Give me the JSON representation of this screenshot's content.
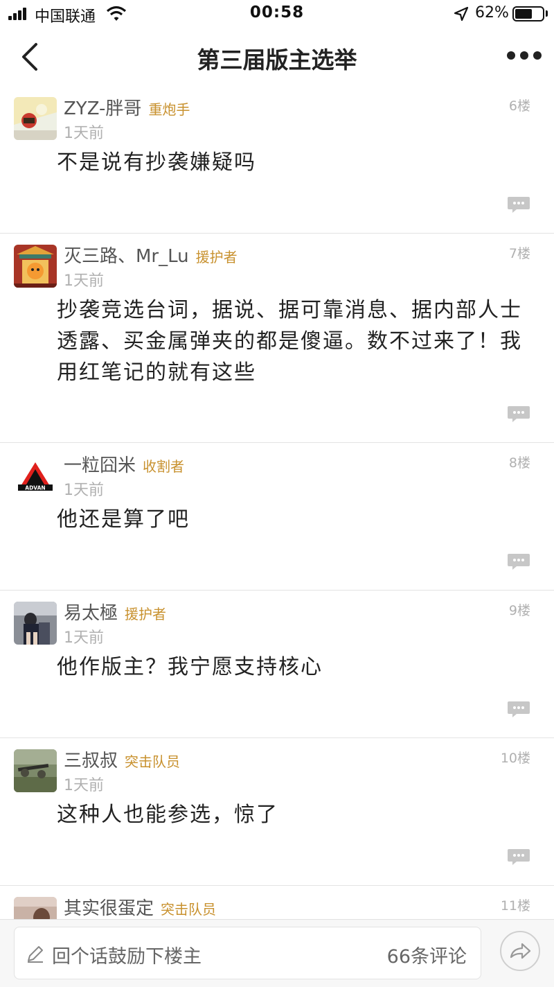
{
  "status_bar": {
    "carrier": "中国联通",
    "time": "00:58",
    "battery_pct": "62%",
    "battery_level": 0.62
  },
  "nav": {
    "title": "第三届版主选举"
  },
  "comments": [
    {
      "username": "ZYZ-胖哥",
      "badge": "重炮手",
      "floor": "6楼",
      "time": "1天前",
      "text": "不是说有抄袭嫌疑吗"
    },
    {
      "username": "灭三路、Mr_Lu",
      "badge": "援护者",
      "floor": "7楼",
      "time": "1天前",
      "text": "抄袭竞选台词，据说、据可靠消息、据内部人士透露、买金属弹夹的都是傻逼。数不过来了！我用红笔记的就有这些"
    },
    {
      "username": "一粒囧米",
      "badge": "收割者",
      "floor": "8楼",
      "time": "1天前",
      "text": "他还是算了吧"
    },
    {
      "username": "易太極",
      "badge": "援护者",
      "floor": "9楼",
      "time": "1天前",
      "text": "他作版主？我宁愿支持核心"
    },
    {
      "username": "三叔叔",
      "badge": "突击队员",
      "floor": "10楼",
      "time": "1天前",
      "text": "这种人也能参选，惊了"
    },
    {
      "username": "其实很蛋定",
      "badge": "突击队员",
      "floor": "11楼"
    }
  ],
  "avatars": {
    "advan_logo_text": "ADVAN"
  },
  "bottom_bar": {
    "placeholder": "回个话鼓励下楼主",
    "comment_count": "66条评论"
  },
  "colors": {
    "badge": "#c8912e",
    "muted": "#b0b0b0",
    "text": "#222222"
  }
}
